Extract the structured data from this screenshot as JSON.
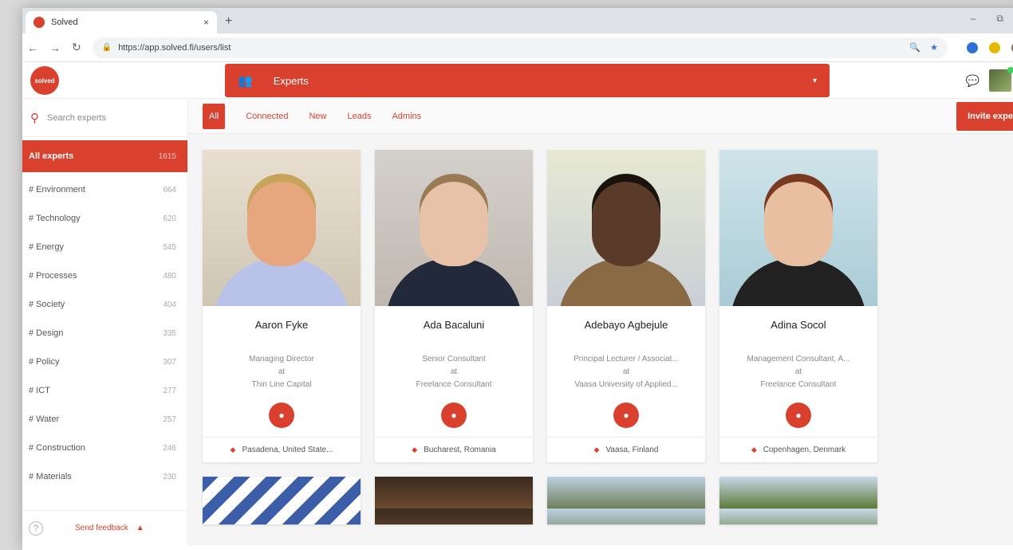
{
  "browser": {
    "tab_title": "Solved",
    "tab_close": "×",
    "new_tab": "+",
    "url": "https://app.solved.fi/users/list",
    "win_min": "–",
    "win_max": "⧉"
  },
  "header": {
    "logo_text": "solved",
    "section": "Experts",
    "chevron": "▾"
  },
  "sidebar": {
    "search_placeholder": "Search experts",
    "categories": [
      {
        "label": "All experts",
        "count": "1615"
      },
      {
        "label": "# Environment",
        "count": "664"
      },
      {
        "label": "# Technology",
        "count": "620"
      },
      {
        "label": "# Energy",
        "count": "545"
      },
      {
        "label": "# Processes",
        "count": "480"
      },
      {
        "label": "# Society",
        "count": "404"
      },
      {
        "label": "# Design",
        "count": "335"
      },
      {
        "label": "# Policy",
        "count": "307"
      },
      {
        "label": "# ICT",
        "count": "277"
      },
      {
        "label": "# Water",
        "count": "257"
      },
      {
        "label": "# Construction",
        "count": "246"
      },
      {
        "label": "# Materials",
        "count": "230"
      }
    ],
    "feedback_label": "Send feedback",
    "help": "?",
    "caret": "▲"
  },
  "filters": [
    "All",
    "Connected",
    "New",
    "Leads",
    "Admins"
  ],
  "invite_label": "Invite experts",
  "experts": [
    {
      "name": "Aaron Fyke",
      "role": "Managing Director",
      "at": "at",
      "org": "Thin Line Capital",
      "location": "Pasadena, United State..."
    },
    {
      "name": "Ada Bacaluni",
      "role": "Senior Consultant",
      "at": "at",
      "org": "Freelance Consultant",
      "location": "Bucharest, Romania"
    },
    {
      "name": "Adebayo Agbejule",
      "role": "Principal Lecturer / Associat...",
      "at": "at",
      "org": "Vaasa University of Applied...",
      "location": "Vaasa, Finland"
    },
    {
      "name": "Adina Socol",
      "role": "Management Consultant, A...",
      "at": "at",
      "org": "Freelance Consultant",
      "location": "Copenhagen, Denmark"
    }
  ],
  "colors": {
    "accent": "#d9412e"
  }
}
